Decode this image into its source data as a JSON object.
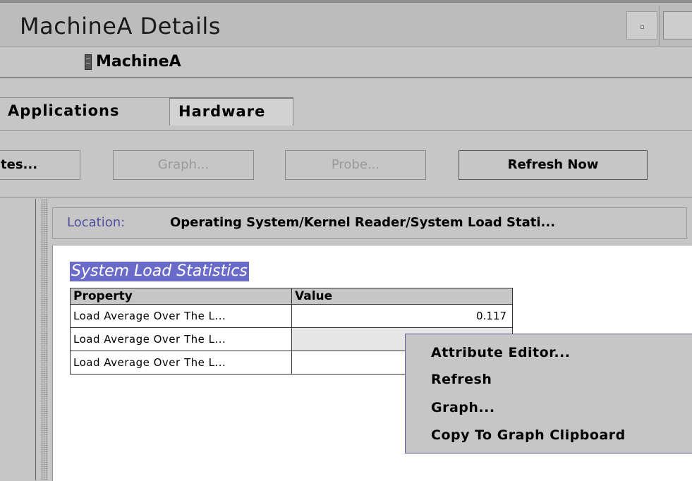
{
  "window": {
    "title": "MachineA Details"
  },
  "machine": {
    "name": "MachineA",
    "icon": "server-icon"
  },
  "tabs": [
    {
      "label": "Applications",
      "active": false
    },
    {
      "label": "Hardware",
      "active": true
    }
  ],
  "toolbar": {
    "prev_label": "tes...",
    "graph_label": "Graph...",
    "graph_enabled": false,
    "probe_label": "Probe...",
    "probe_enabled": false,
    "refresh_label": "Refresh Now"
  },
  "location": {
    "label": "Location:",
    "path": "Operating System/Kernel Reader/System Load Stati..."
  },
  "section": {
    "title": "System Load Statistics"
  },
  "table": {
    "columns": [
      "Property",
      "Value"
    ],
    "rows": [
      {
        "property": "Load Average Over The L...",
        "value": "0.117"
      },
      {
        "property": "Load Average Over The L...",
        "value": ""
      },
      {
        "property": "Load Average Over The L...",
        "value": ""
      }
    ]
  },
  "context_menu": {
    "items": [
      "Attribute Editor...",
      "Refresh",
      "Graph...",
      "Copy To Graph Clipboard"
    ]
  },
  "colors": {
    "background": "#c6c6c6",
    "selection": "#6a6ac8",
    "location_label": "#4e4fa0",
    "disabled_text": "#9a9a9a"
  }
}
